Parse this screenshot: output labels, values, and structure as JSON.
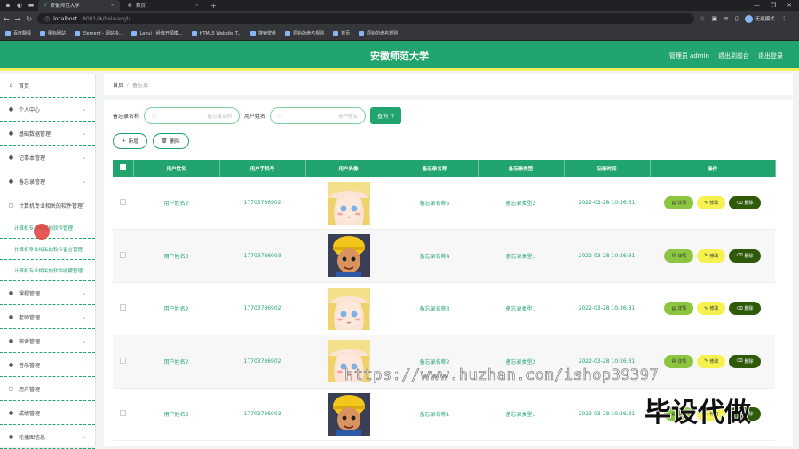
{
  "browser": {
    "tabs": [
      {
        "title": "安徽师范大学",
        "active": true
      },
      {
        "title": "首页",
        "active": false
      }
    ],
    "url_host": "localhost",
    "url_rest": ":8081/#/beiwanglu",
    "profile_label": "无痕模式",
    "bookmarks": [
      "百度翻译",
      "图标网站",
      "Element - 网站快...",
      "Layui - 经典开源模...",
      "HTML5 Website T...",
      "搜索壁纸",
      "原始的命名规则",
      "首页",
      "原始的命名规则"
    ]
  },
  "header": {
    "title": "安徽师范大学",
    "user": "管理员 admin",
    "links": [
      "退出到前台",
      "退出登录"
    ]
  },
  "sidebar": {
    "items": [
      {
        "label": "首页",
        "icon": "home-icon",
        "chevron": false
      },
      {
        "label": "个人中心",
        "icon": "user-icon",
        "chevron": true
      },
      {
        "label": "基础数据管理",
        "icon": "user-icon",
        "chevron": true
      },
      {
        "label": "记事本管理",
        "icon": "user-icon",
        "chevron": true
      },
      {
        "label": "备忘录管理",
        "icon": "user-icon",
        "chevron": true
      },
      {
        "label": "计算机专业相关的软件管理",
        "icon": "doc-icon",
        "chevron": true
      }
    ],
    "subitems": [
      "计算机专业相关的软件管理",
      "计算机专业相关的软件留言管理",
      "计算机专业相关的软件收藏管理"
    ],
    "items_after": [
      {
        "label": "课程管理",
        "icon": "user-icon"
      },
      {
        "label": "老师管理",
        "icon": "user-icon"
      },
      {
        "label": "宿舍管理",
        "icon": "user-icon"
      },
      {
        "label": "音乐管理",
        "icon": "user-icon"
      },
      {
        "label": "用户管理",
        "icon": "doc-icon"
      },
      {
        "label": "成绩管理",
        "icon": "user-icon"
      },
      {
        "label": "轮播图信息",
        "icon": "user-icon"
      }
    ]
  },
  "breadcrumb": {
    "home": "首页",
    "sep": "/",
    "current": "备忘录"
  },
  "search": {
    "label1": "备忘录名称",
    "placeholder1": "备忘录名称",
    "label2": "用户姓名",
    "placeholder2": "用户姓名",
    "button": "查询"
  },
  "actions": {
    "add": "新增",
    "delete": "删除"
  },
  "table": {
    "columns": [
      "用户姓名",
      "用户手机号",
      "用户头像",
      "备忘录名称",
      "备忘录类型",
      "记录时间",
      "操作"
    ],
    "rows": [
      {
        "name": "用户姓名2",
        "phone": "17703786902",
        "avatar": "girl",
        "memo": "备忘录名称5",
        "type": "备忘录类型2",
        "time": "2022-03-28 10:36:31"
      },
      {
        "name": "用户姓名3",
        "phone": "17703786903",
        "avatar": "boy",
        "memo": "备忘录名称4",
        "type": "备忘录类型1",
        "time": "2022-03-28 10:36:31"
      },
      {
        "name": "用户姓名2",
        "phone": "17703786902",
        "avatar": "girl",
        "memo": "备忘录名称3",
        "type": "备忘录类型1",
        "time": "2022-03-28 10:36:31"
      },
      {
        "name": "用户姓名2",
        "phone": "17703786902",
        "avatar": "girl",
        "memo": "备忘录名称2",
        "type": "备忘录类型2",
        "time": "2022-03-28 10:36:31"
      },
      {
        "name": "用户姓名3",
        "phone": "17703786903",
        "avatar": "boy",
        "memo": "备忘录名称1",
        "type": "备忘录类型1",
        "time": "2022-03-28 10:36:31"
      }
    ],
    "op_labels": {
      "detail": "详情",
      "edit": "修改",
      "delete": "删除"
    }
  },
  "overlay": {
    "watermark": "https://www.huzhan.com/ishop39397",
    "stamp": "毕设代做"
  },
  "colors": {
    "primary": "#22a46e",
    "accent": "#f2f15a",
    "detail": "#8cc641",
    "edit": "#f5f250",
    "delete": "#2e5a0a"
  }
}
